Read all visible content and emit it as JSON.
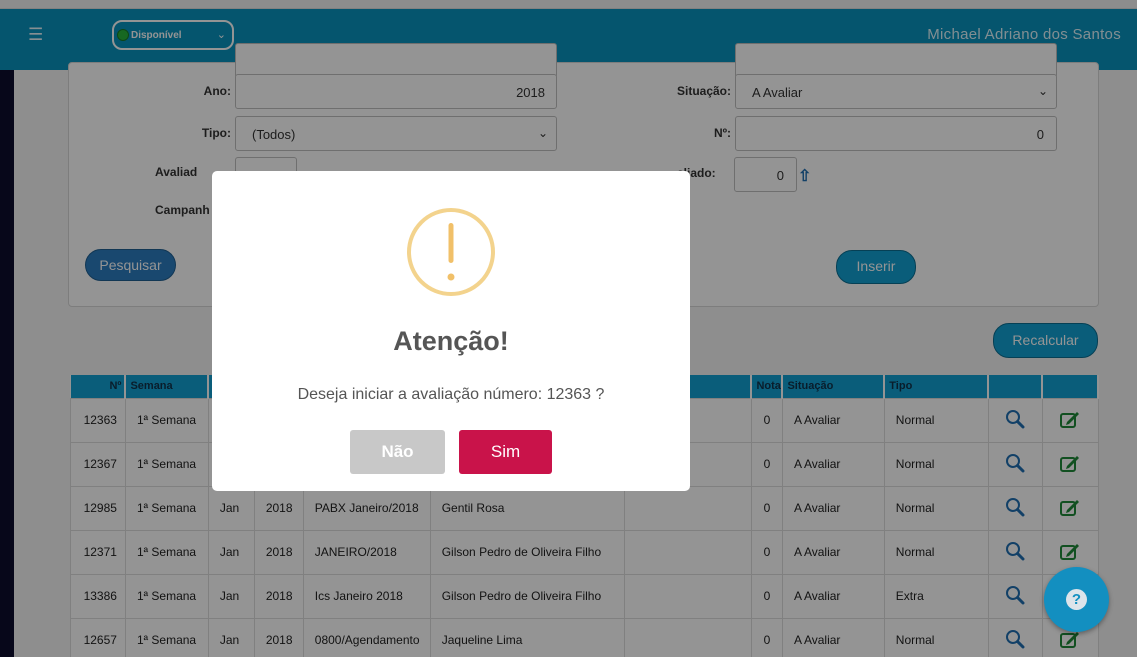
{
  "topbar": {
    "menu_icon": "hamburger-icon",
    "status_value": "Disponível",
    "status_color": "#29b33a",
    "user_name": "Michael Adriano dos Santos"
  },
  "filters": {
    "ano_label": "Ano:",
    "ano_value": "2018",
    "situacao_label": "Situação:",
    "situacao_value": "A Avaliar",
    "tipo_label": "Tipo:",
    "tipo_value": "(Todos)",
    "numero_label": "Nº:",
    "numero_value": "0",
    "avaliador_label_partial": "Avaliad",
    "avaliado_label_partial": "aliado:",
    "avaliado_value": "0",
    "campanha_label_partial": "Campanh",
    "pesquisar_label": "Pesquisar",
    "inserir_label": "Inserir"
  },
  "recalcular_label": "Recalcular",
  "table": {
    "headers": [
      "Nº",
      "Semana",
      "",
      "",
      "",
      "",
      "",
      "Nota",
      "Situação",
      "Tipo",
      "",
      ""
    ],
    "rows": [
      {
        "num": "12363",
        "semana": "1ª Semana",
        "mes": "",
        "ano": "",
        "campanha": "",
        "avaliado": "",
        "extra": "",
        "nota": "0",
        "situacao": "A Avaliar",
        "tipo": "Normal"
      },
      {
        "num": "12367",
        "semana": "1ª Semana",
        "mes": "",
        "ano": "",
        "campanha": "",
        "avaliado": "",
        "extra": "",
        "nota": "0",
        "situacao": "A Avaliar",
        "tipo": "Normal"
      },
      {
        "num": "12985",
        "semana": "1ª Semana",
        "mes": "Jan",
        "ano": "2018",
        "campanha": "PABX Janeiro/2018",
        "avaliado": "Gentil Rosa",
        "extra": "",
        "nota": "0",
        "situacao": "A Avaliar",
        "tipo": "Normal"
      },
      {
        "num": "12371",
        "semana": "1ª Semana",
        "mes": "Jan",
        "ano": "2018",
        "campanha": "JANEIRO/2018",
        "avaliado": "Gilson Pedro de Oliveira Filho",
        "extra": "",
        "nota": "0",
        "situacao": "A Avaliar",
        "tipo": "Normal"
      },
      {
        "num": "13386",
        "semana": "1ª Semana",
        "mes": "Jan",
        "ano": "2018",
        "campanha": "Ics Janeiro 2018",
        "avaliado": "Gilson Pedro de Oliveira Filho",
        "extra": "",
        "nota": "0",
        "situacao": "A Avaliar",
        "tipo": "Extra"
      },
      {
        "num": "12657",
        "semana": "1ª Semana",
        "mes": "Jan",
        "ano": "2018",
        "campanha": "0800/Agendamento",
        "avaliado": "Jaqueline Lima",
        "extra": "",
        "nota": "0",
        "situacao": "A Avaliar",
        "tipo": "Normal"
      }
    ]
  },
  "modal": {
    "icon": "warning-exclamation-icon",
    "title": "Atenção!",
    "message": "Deseja iniciar a avaliação número: 12363 ?",
    "no_label": "Não",
    "yes_label": "Sim",
    "yes_color": "#c9134a"
  },
  "help_label": "?"
}
